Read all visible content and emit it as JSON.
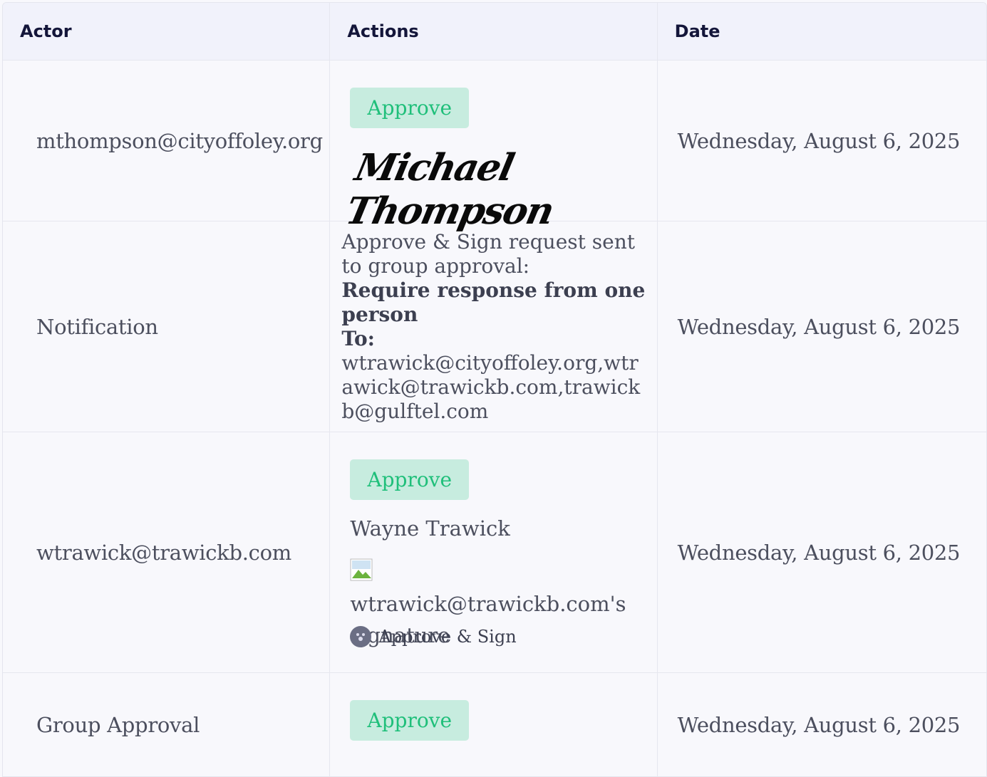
{
  "headers": {
    "actor": "Actor",
    "actions": "Actions",
    "date": "Date"
  },
  "rows": [
    {
      "actor": "mthompson@cityoffoley.org",
      "action_button": "Approve",
      "signature_text": "Michael Thompson",
      "date": "Wednesday, August 6, 2025"
    },
    {
      "actor": "Notification",
      "line1": "Approve & Sign request sent to group approval:",
      "bold1": "Require response from one person",
      "bold2": "To:",
      "recipients": "wtrawick@cityoffoley.org,wtrawick@trawickb.com,trawickb@gulftel.com",
      "date": "Wednesday, August 6, 2025"
    },
    {
      "actor": "wtrawick@trawickb.com",
      "action_button": "Approve",
      "signer_name": "Wayne Trawick",
      "signature_alt": "wtrawick@trawickb.com's signature",
      "method": "Approve & Sign",
      "date": "Wednesday, August 6, 2025"
    },
    {
      "actor": "Group Approval",
      "action_button": "Approve",
      "date": "Wednesday, August 6, 2025"
    }
  ],
  "colors": {
    "approve_bg": "#c7ecdf",
    "approve_text": "#1fbf7a",
    "header_bg": "#f1f2fb"
  },
  "icons": {
    "method_icon": "face-icon",
    "broken_image": "broken-image-icon"
  }
}
